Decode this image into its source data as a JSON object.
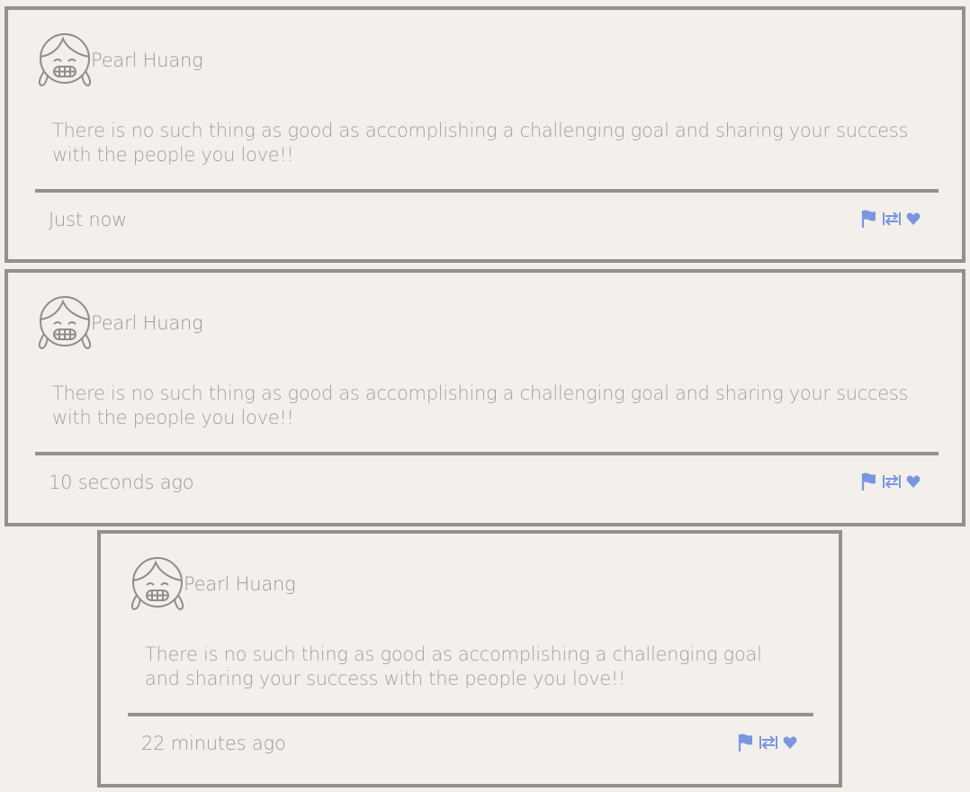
{
  "colors": {
    "page_bg": "#f2efea",
    "border": "#929090",
    "text": "#a3a1a1",
    "accent": "#7a96e0"
  },
  "posts": [
    {
      "author": "Pearl Huang",
      "message": "There is no such thing as good as accomplishing a challenging goal and sharing your success with the people you love!!",
      "time": "Just now",
      "avatar_icon": "girl-avatar-icon",
      "actions": [
        "flag-icon",
        "retweet-icon",
        "heart-icon"
      ]
    },
    {
      "author": "Pearl Huang",
      "message": "There is no such thing as good as accomplishing a challenging goal and sharing your success with the people you love!!",
      "time": "10 seconds ago",
      "avatar_icon": "girl-avatar-icon",
      "actions": [
        "flag-icon",
        "retweet-icon",
        "heart-icon"
      ]
    },
    {
      "author": "Pearl Huang",
      "message": "There is no such thing as good as accomplishing a challenging goal and sharing your success with the people you love!!",
      "time": "22 minutes ago",
      "avatar_icon": "girl-avatar-icon",
      "actions": [
        "flag-icon",
        "retweet-icon",
        "heart-icon"
      ]
    }
  ]
}
